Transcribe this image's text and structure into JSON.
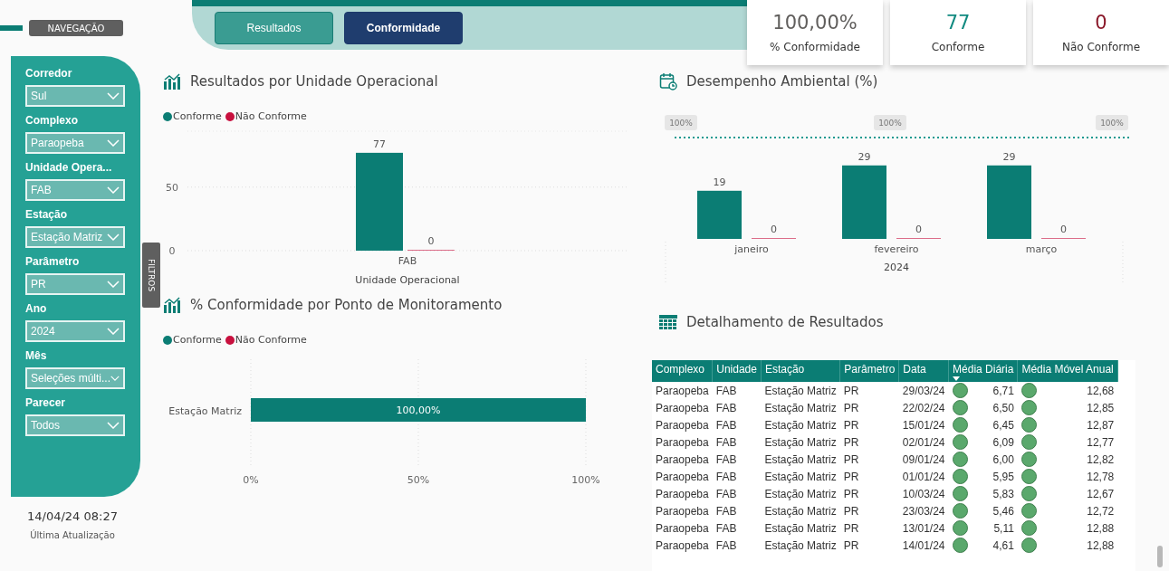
{
  "navigation": {
    "label": "NAVEGAÇÃO"
  },
  "tabs": [
    {
      "label": "Resultados",
      "selected": false
    },
    {
      "label": "Conformidade",
      "selected": true
    }
  ],
  "kpis": [
    {
      "value": "100,00%",
      "label": "% Conformidade",
      "color": "#605e5c"
    },
    {
      "value": "77",
      "label": "Conforme",
      "color": "#118a80"
    },
    {
      "value": "0",
      "label": "Não Conforme",
      "color": "#8b1a2b"
    }
  ],
  "filters": [
    {
      "label": "Corredor",
      "value": "Sul"
    },
    {
      "label": "Complexo",
      "value": "Paraopeba"
    },
    {
      "label": "Unidade Opera...",
      "value": "FAB"
    },
    {
      "label": "Estação",
      "value": "Estação Matriz"
    },
    {
      "label": "Parâmetro",
      "value": "PR"
    },
    {
      "label": "Ano",
      "value": "2024"
    },
    {
      "label": "Mês",
      "value": "Seleções múlti..."
    },
    {
      "label": "Parecer",
      "value": "Todos"
    }
  ],
  "filters_tab": {
    "label": "FILTROS"
  },
  "last_update": {
    "value": "14/04/24 08:27",
    "label": "Última Atualização"
  },
  "unit_chart": {
    "title": "Resultados por Unidade Operacional",
    "chart_data": {
      "type": "bar",
      "xlabel": "Unidade Operacional",
      "categories": [
        "FAB"
      ],
      "yticks": [
        0,
        50
      ],
      "ylim": [
        0,
        94
      ],
      "data_labels": true,
      "series": [
        {
          "name": "Conforme",
          "color": "#0b7d74",
          "values": [
            77
          ]
        },
        {
          "name": "Não Conforme",
          "color": "#c8103e",
          "values": [
            0
          ]
        }
      ]
    }
  },
  "point_chart": {
    "title": "% Conformidade por Ponto de Monitoramento",
    "chart_data": {
      "type": "bar",
      "orientation": "horizontal",
      "categories": [
        "Estação Matriz"
      ],
      "xlim": [
        0,
        100
      ],
      "xticks": [
        {
          "value": 0,
          "label": "0%"
        },
        {
          "value": 50,
          "label": "50%"
        },
        {
          "value": 100,
          "label": "100%"
        }
      ],
      "value_labels": [
        "100,00%"
      ],
      "series": [
        {
          "name": "Conforme",
          "color": "#0b7d74",
          "values": [
            100
          ]
        },
        {
          "name": "Não Conforme",
          "color": "#c8103e",
          "values": [
            0
          ]
        }
      ]
    }
  },
  "environment_chart": {
    "title": "Desempenho Ambiental (%)",
    "chart_data": {
      "type": "bar",
      "xlabel": "2024",
      "categories": [
        "janeiro",
        "fevereiro",
        "março"
      ],
      "ylim": [
        0,
        40
      ],
      "data_labels": true,
      "annotations": [
        "100%",
        "100%",
        "100%"
      ],
      "series": [
        {
          "color": "#0b7d74",
          "values": [
            19,
            29,
            29
          ]
        },
        {
          "color": "#c8103e",
          "values": [
            0,
            0,
            0
          ]
        }
      ]
    }
  },
  "detail_table": {
    "title": "Detalhamento de Resultados",
    "columns": [
      {
        "label": "Complexo",
        "sorted": false
      },
      {
        "label": "Unidade",
        "sorted": false
      },
      {
        "label": "Estação",
        "sorted": false
      },
      {
        "label": "Parâmetro",
        "sorted": false
      },
      {
        "label": "Data",
        "sorted": false
      },
      {
        "label": "Média Diária",
        "sorted": true
      },
      {
        "label": "Média Móvel Anual",
        "sorted": false
      }
    ],
    "rows": [
      [
        "Paraopeba",
        "FAB",
        "Estação Matriz",
        "PR",
        "29/03/24",
        "6,71",
        "12,68"
      ],
      [
        "Paraopeba",
        "FAB",
        "Estação Matriz",
        "PR",
        "22/02/24",
        "6,50",
        "12,85"
      ],
      [
        "Paraopeba",
        "FAB",
        "Estação Matriz",
        "PR",
        "15/01/24",
        "6,45",
        "12,87"
      ],
      [
        "Paraopeba",
        "FAB",
        "Estação Matriz",
        "PR",
        "02/01/24",
        "6,09",
        "12,77"
      ],
      [
        "Paraopeba",
        "FAB",
        "Estação Matriz",
        "PR",
        "09/01/24",
        "6,00",
        "12,82"
      ],
      [
        "Paraopeba",
        "FAB",
        "Estação Matriz",
        "PR",
        "01/01/24",
        "5,95",
        "12,78"
      ],
      [
        "Paraopeba",
        "FAB",
        "Estação Matriz",
        "PR",
        "10/03/24",
        "5,83",
        "12,67"
      ],
      [
        "Paraopeba",
        "FAB",
        "Estação Matriz",
        "PR",
        "23/03/24",
        "5,46",
        "12,72"
      ],
      [
        "Paraopeba",
        "FAB",
        "Estação Matriz",
        "PR",
        "13/01/24",
        "5,11",
        "12,88"
      ],
      [
        "Paraopeba",
        "FAB",
        "Estação Matriz",
        "PR",
        "14/01/24",
        "4,61",
        "12,88"
      ]
    ]
  }
}
